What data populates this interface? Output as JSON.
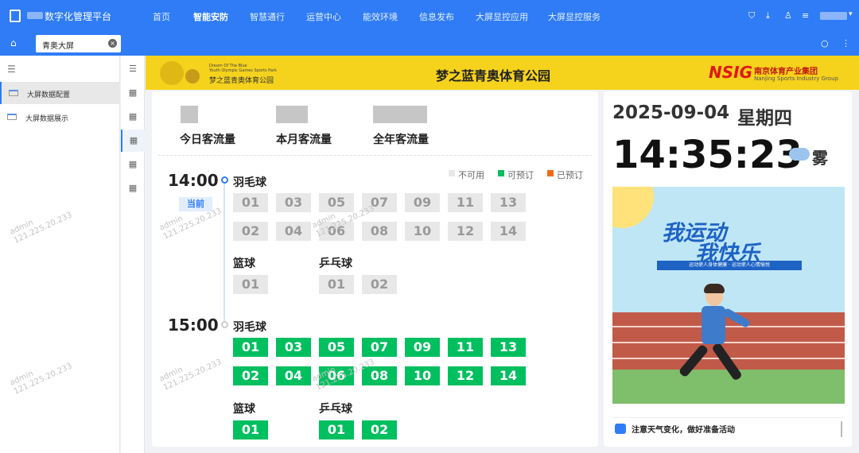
{
  "app": {
    "title": "数字化管理平台"
  },
  "nav": [
    "首页",
    "智能安防",
    "智慧通行",
    "运营中心",
    "能效环境",
    "信息发布",
    "大屏显控应用",
    "大屏显控服务"
  ],
  "nav_active": "智能安防",
  "tabs": {
    "current": "青奥大屏",
    "close": "×"
  },
  "sidebar": {
    "items": [
      {
        "label": "大屏数据配置",
        "active": true
      },
      {
        "label": "大屏数据展示",
        "active": false
      }
    ]
  },
  "banner": {
    "logo_en_line1": "Dream Of The Blue",
    "logo_en_line2": "Youth Olympic Games Sports Park",
    "logo_cn": "梦之蓝青奥体育公园",
    "title": "梦之蓝青奥体育公园",
    "group_logo": "NSIG",
    "group_cn": "南京体育产业集团",
    "group_en": "Nanjing Sports Industry Group"
  },
  "stats": [
    {
      "label": "今日客流量"
    },
    {
      "label": "本月客流量"
    },
    {
      "label": "全年客流量"
    }
  ],
  "legend": [
    {
      "label": "不可用",
      "color": "#e8e8e8"
    },
    {
      "label": "可预订",
      "color": "#00bf5f"
    },
    {
      "label": "已预订",
      "color": "#f06a1b"
    }
  ],
  "schedule": [
    {
      "time": "14:00",
      "current_label": "当前",
      "status": "不可用",
      "badminton": {
        "name": "羽毛球",
        "courts": [
          "01",
          "03",
          "05",
          "07",
          "09",
          "11",
          "13",
          "02",
          "04",
          "06",
          "08",
          "10",
          "12",
          "14"
        ]
      },
      "basketball": {
        "name": "篮球",
        "courts": [
          "01"
        ]
      },
      "pingpong": {
        "name": "乒乓球",
        "courts": [
          "01",
          "02"
        ]
      }
    },
    {
      "time": "15:00",
      "status": "可预订",
      "badminton": {
        "name": "羽毛球",
        "courts": [
          "01",
          "03",
          "05",
          "07",
          "09",
          "11",
          "13",
          "02",
          "04",
          "06",
          "08",
          "10",
          "12",
          "14"
        ]
      },
      "basketball": {
        "name": "篮球",
        "courts": [
          "01"
        ]
      },
      "pingpong": {
        "name": "乒乓球",
        "courts": [
          "01",
          "02"
        ]
      }
    }
  ],
  "right": {
    "date": "2025-09-04",
    "weekday": "星期四",
    "clock": "14:35:23",
    "weather": "雾",
    "poster_line1": "我运动",
    "poster_line2": "我快乐",
    "poster_sub": "运动使人身体健康 · 运动使人心情愉悦",
    "notice": "注意天气变化，做好准备活动"
  },
  "watermark": {
    "line1": "admin",
    "line2": "121.225.20.233"
  }
}
